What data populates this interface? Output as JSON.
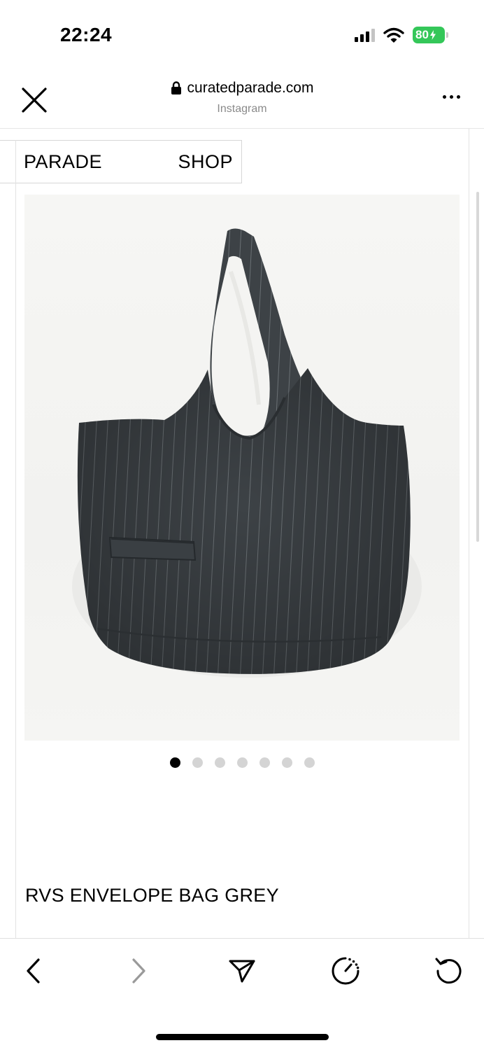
{
  "status_bar": {
    "time": "22:24",
    "battery": "80",
    "signal_icon": "cellular-signal-icon",
    "wifi_icon": "wifi-icon"
  },
  "browser": {
    "url": "curatedparade.com",
    "source": "Instagram",
    "close_icon": "close-icon",
    "lock_icon": "lock-icon",
    "more_icon": "more-icon"
  },
  "site_nav": {
    "brand": "PARADE",
    "shop": "SHOP"
  },
  "product": {
    "title": "RVS ENVELOPE BAG GREY",
    "image_count": 7,
    "active_image": 1,
    "image_subject": "striped-tote-bag"
  },
  "toolbar": {
    "back_icon": "chevron-left-icon",
    "forward_icon": "chevron-right-icon",
    "share_icon": "send-icon",
    "speed_icon": "speedometer-icon",
    "reload_icon": "reload-icon"
  },
  "colors": {
    "battery": "#34c759",
    "bag": "#3d4246",
    "border": "#d6d6d6"
  }
}
